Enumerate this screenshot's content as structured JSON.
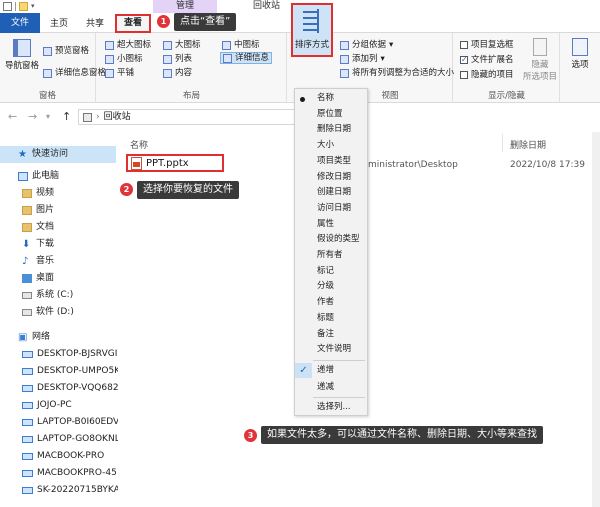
{
  "titlebar": {
    "manage_tab": "管理",
    "title": "回收站"
  },
  "tabs": {
    "file": "文件",
    "home": "主页",
    "share": "共享",
    "view": "查看"
  },
  "ribbon": {
    "pane": {
      "nav_pane": "导航窗格",
      "preview_pane": "预览窗格",
      "details_pane": "详细信息窗格",
      "label": "窗格"
    },
    "layout": {
      "label": "布局",
      "items": [
        "超大图标",
        "大图标",
        "中图标",
        "小图标",
        "列表",
        "详细信息",
        "平铺",
        "内容"
      ]
    },
    "current_view": {
      "sort_by": "排序方式",
      "group_by": "分组依据",
      "add_column": "添加列",
      "fit_columns": "将所有列调整为合适的大小",
      "label": "视图"
    },
    "show_hide": {
      "label": "显示/隐藏",
      "item_checkboxes": "项目复选框",
      "file_extensions": "文件扩展名",
      "hidden_items": "隐藏的项目",
      "hide_selected": "隐藏",
      "hide_selected_2": "所选项目",
      "options": "选项"
    }
  },
  "address": {
    "path": "回收站"
  },
  "nav": {
    "quick_access": "快速访问",
    "this_pc": "此电脑",
    "videos": "视频",
    "pictures": "图片",
    "documents": "文档",
    "downloads": "下载",
    "music": "音乐",
    "desktop": "桌面",
    "drive_c": "系统 (C:)",
    "drive_d": "软件 (D:)",
    "network": "网络",
    "hosts": [
      "DESKTOP-BJSRVGI",
      "DESKTOP-UMPO5K",
      "DESKTOP-VQQ682",
      "JOJO-PC",
      "LAPTOP-B0I60EDV",
      "LAPTOP-GO8OKNL",
      "MACBOOK-PRO",
      "MACBOOKPRO-45",
      "SK-20220715BYKA"
    ]
  },
  "content": {
    "col_name": "名称",
    "col_deleted": "删除日期",
    "file": {
      "name": "PPT.pptx",
      "location": "ministrator\\Desktop",
      "deleted": "2022/10/8 17:39"
    }
  },
  "sort_menu": {
    "items": [
      "名称",
      "原位置",
      "删除日期",
      "大小",
      "项目类型",
      "修改日期",
      "创建日期",
      "访问日期",
      "属性",
      "假设的类型",
      "所有者",
      "标记",
      "分级",
      "作者",
      "标题",
      "备注",
      "文件说明"
    ],
    "ascending": "递增",
    "descending": "递减",
    "choose_columns": "选择列..."
  },
  "callouts": {
    "step1_num": "1",
    "step1": "点击“查看”",
    "step2_num": "2",
    "step2": "选择你要恢复的文件",
    "step3_num": "3",
    "step3": "如果文件太多，可以通过文件名称、删除日期、大小等来查找"
  }
}
